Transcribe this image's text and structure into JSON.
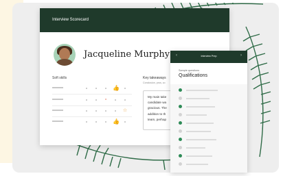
{
  "scorecard": {
    "title": "Interview Scorecard",
    "candidate_name": "Jacqueline Murphy",
    "soft_skills_label": "Soft skills",
    "key_takeaways_label": "Key takeaways",
    "key_takeaways_subtitle": "Conclusion, pros, co",
    "quote_lines": [
      "My main take",
      "candidate wa",
      "gracious. The",
      "addition to th",
      "team, perhap"
    ]
  },
  "prep": {
    "header_title": "Interview Prep",
    "kicker": "Sample questions",
    "title": "Qualifications",
    "options_selected": [
      true,
      false,
      true,
      false,
      true,
      false,
      true,
      false,
      true,
      false
    ]
  },
  "colors": {
    "brand_dark_green": "#1f3a2b",
    "accent_green": "#2e8b57",
    "flag_red": "#e05a3a",
    "star_orange": "#e89a2c"
  },
  "icons": [
    "thumbs-up-icon",
    "speech-flag-icon",
    "star-icon",
    "chevron-left-icon",
    "chevron-right-icon"
  ]
}
